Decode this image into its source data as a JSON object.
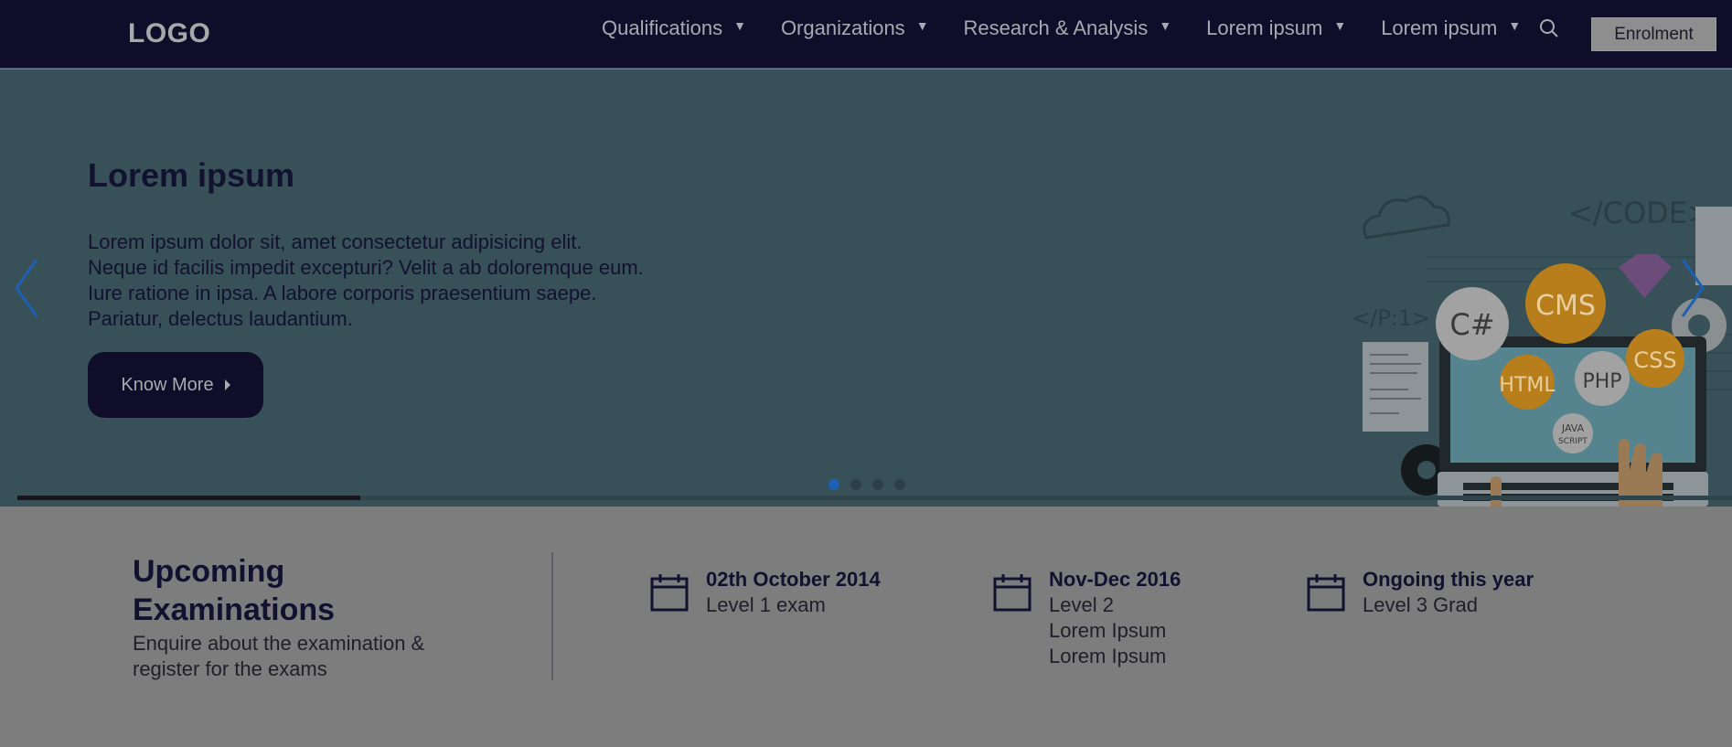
{
  "nav": {
    "logo": "LOGO",
    "items": [
      {
        "label": "Qualifications"
      },
      {
        "label": "Organizations"
      },
      {
        "label": "Research & Analysis"
      },
      {
        "label": "Lorem ipsum"
      },
      {
        "label": "Lorem ipsum"
      }
    ],
    "enrol_label": "Enrolment"
  },
  "hero": {
    "title": "Lorem ipsum",
    "body_lines": [
      "Lorem ipsum dolor sit, amet consectetur adipisicing elit.",
      "Neque id facilis impedit excepturi? Velit a ab doloremque eum.",
      "Iure ratione in ipsa. A labore corporis praesentium saepe.",
      "Pariatur, delectus laudantium."
    ],
    "button_label": "Know More",
    "slide_count": 4,
    "active_slide": 1,
    "progress_fraction": 0.2,
    "illustration_labels": {
      "code": "</CODE>",
      "p1": "</P:1>",
      "csharp": "C#",
      "cms": "CMS",
      "css": "CSS",
      "html": "HTML",
      "php": "PHP",
      "java_line1": "JAVA",
      "java_line2": "SCRIPT"
    }
  },
  "exams": {
    "title_line1": "Upcoming",
    "title_line2": "Examinations",
    "subtitle_line1": "Enquire about the examination &",
    "subtitle_line2": "register for the exams",
    "items": [
      {
        "date": "02th October 2014",
        "lines": [
          "Level 1 exam"
        ]
      },
      {
        "date": "Nov-Dec 2016",
        "lines": [
          "Level 2",
          "Lorem Ipsum",
          "Lorem Ipsum"
        ]
      },
      {
        "date": "Ongoing this year",
        "lines": [
          "Level 3 Grad"
        ]
      }
    ]
  },
  "colors": {
    "nav_bg": "#0f0d29",
    "hero_bg": "#385057",
    "exams_bg": "#7d7d7d",
    "accent_blue": "#1d5fb3",
    "badge_orange": "#b87e1c"
  }
}
